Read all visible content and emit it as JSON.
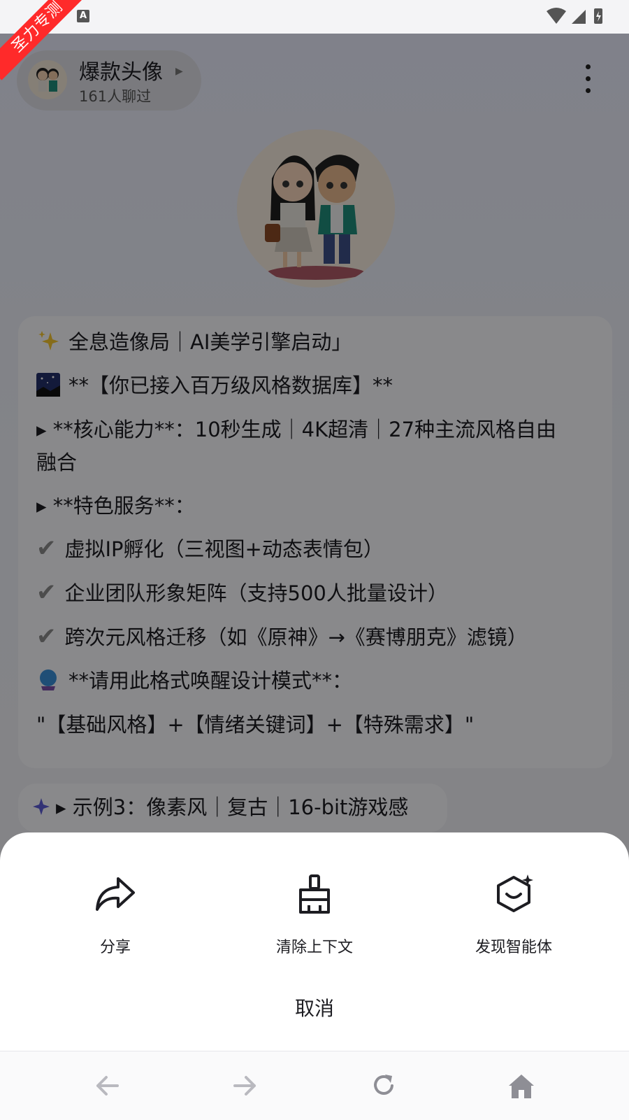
{
  "status_bar": {
    "badge_letter": "A"
  },
  "ribbon": {
    "text": "圣力专测"
  },
  "header": {
    "bot_name": "爆款头像",
    "chat_count": "161人聊过"
  },
  "message": {
    "line1": "全息造像局｜AI美学引擎启动」",
    "line2": "**【你已接入百万级风格数据库】**",
    "line3": "▸ **核心能力**：10秒生成｜4K超清｜27种主流风格自由",
    "line3b": "融合",
    "line4": "▸ **特色服务**：",
    "line5": "虚拟IP孵化（三视图+动态表情包）",
    "line6": "企业团队形象矩阵（支持500人批量设计）",
    "line7": "跨次元风格迁移（如《原神》→《赛博朋克》滤镜）",
    "line8": "**请用此格式唤醒设计模式**：",
    "line9": "\"【基础风格】+【情绪关键词】+【特殊需求】\""
  },
  "suggestion": {
    "text": "▸ 示例3：像素风｜复古｜16-bit游戏感"
  },
  "sheet": {
    "actions": [
      {
        "label": "分享",
        "icon": "share-icon"
      },
      {
        "label": "清除上下文",
        "icon": "broom-icon"
      },
      {
        "label": "发现智能体",
        "icon": "discover-agent-icon"
      }
    ],
    "cancel": "取消"
  },
  "nav": {
    "icons": [
      "back-arrow-icon",
      "forward-arrow-icon",
      "refresh-icon",
      "home-icon"
    ]
  },
  "colors": {
    "overlay": "#000000",
    "ribbon": "#ff2a2a",
    "sparkle": "#5b5bd6"
  }
}
